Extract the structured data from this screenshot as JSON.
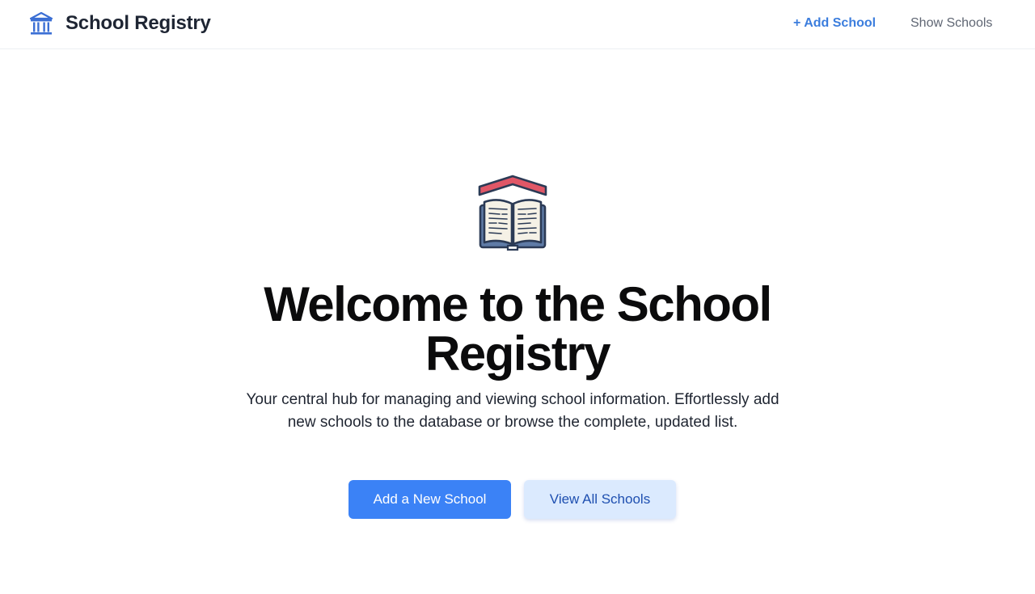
{
  "nav": {
    "brand_icon": "bank-building-icon",
    "brand_title": "School Registry",
    "links": [
      {
        "label": "+ Add School",
        "active": true
      },
      {
        "label": "Show Schools",
        "active": false
      }
    ]
  },
  "hero": {
    "icon": "open-book-roof-icon",
    "title": "Welcome to the School Registry",
    "subtitle": "Your central hub for managing and viewing school information. Effortlessly add new schools to the database or browse the complete, updated list.",
    "primary_button": "Add a New School",
    "secondary_button": "View All Schools"
  },
  "colors": {
    "accent": "#3b82f6",
    "nav_active": "#3b7ddd",
    "secondary_button_bg": "#dbeafe",
    "roof_red": "#e05767",
    "book_navy": "#2b3a55"
  }
}
